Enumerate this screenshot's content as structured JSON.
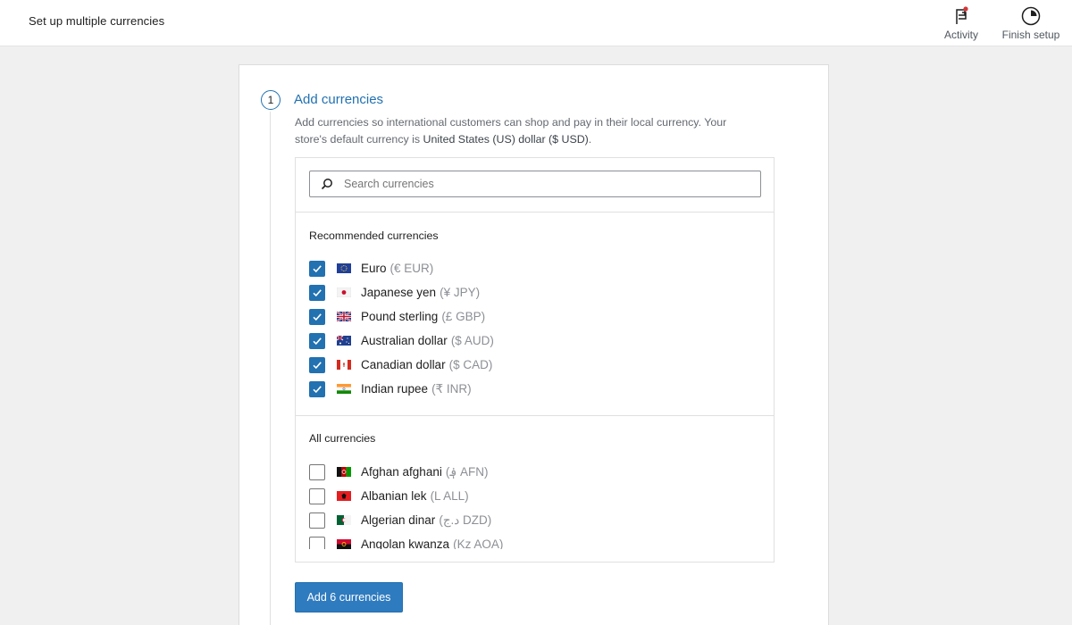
{
  "header": {
    "title": "Set up multiple currencies",
    "tools": [
      {
        "label": "Activity",
        "icon": "flag-icon",
        "has_notification": true
      },
      {
        "label": "Finish setup",
        "icon": "progress-circle-icon"
      }
    ]
  },
  "step": {
    "number": "1",
    "title": "Add currencies",
    "description_prefix": "Add currencies so international customers can shop and pay in their local currency. Your store's default currency is ",
    "default_currency": "United States (US) dollar ($ USD)",
    "description_suffix": "."
  },
  "search": {
    "placeholder": "Search currencies",
    "value": ""
  },
  "recommended": {
    "heading": "Recommended currencies",
    "items": [
      {
        "name": "Euro",
        "code": "(€ EUR)",
        "checked": true,
        "flag": "EU"
      },
      {
        "name": "Japanese yen",
        "code": "(¥ JPY)",
        "checked": true,
        "flag": "JP"
      },
      {
        "name": "Pound sterling",
        "code": "(£ GBP)",
        "checked": true,
        "flag": "GB"
      },
      {
        "name": "Australian dollar",
        "code": "($ AUD)",
        "checked": true,
        "flag": "AU"
      },
      {
        "name": "Canadian dollar",
        "code": "($ CAD)",
        "checked": true,
        "flag": "CA"
      },
      {
        "name": "Indian rupee",
        "code": "(₹ INR)",
        "checked": true,
        "flag": "IN"
      }
    ]
  },
  "all": {
    "heading": "All currencies",
    "items": [
      {
        "name": "Afghan afghani",
        "code": "(؋ AFN)",
        "checked": false,
        "flag": "AF"
      },
      {
        "name": "Albanian lek",
        "code": "(L ALL)",
        "checked": false,
        "flag": "AL"
      },
      {
        "name": "Algerian dinar",
        "code": "(د.ج DZD)",
        "checked": false,
        "flag": "DZ"
      },
      {
        "name": "Angolan kwanza",
        "code": "(Kz AOA)",
        "checked": false,
        "flag": "AO"
      }
    ]
  },
  "actions": {
    "submit_label": "Add 6 currencies"
  },
  "colors": {
    "accent": "#2271b1",
    "button": "#2f7bbf",
    "notification": "#d63638"
  }
}
